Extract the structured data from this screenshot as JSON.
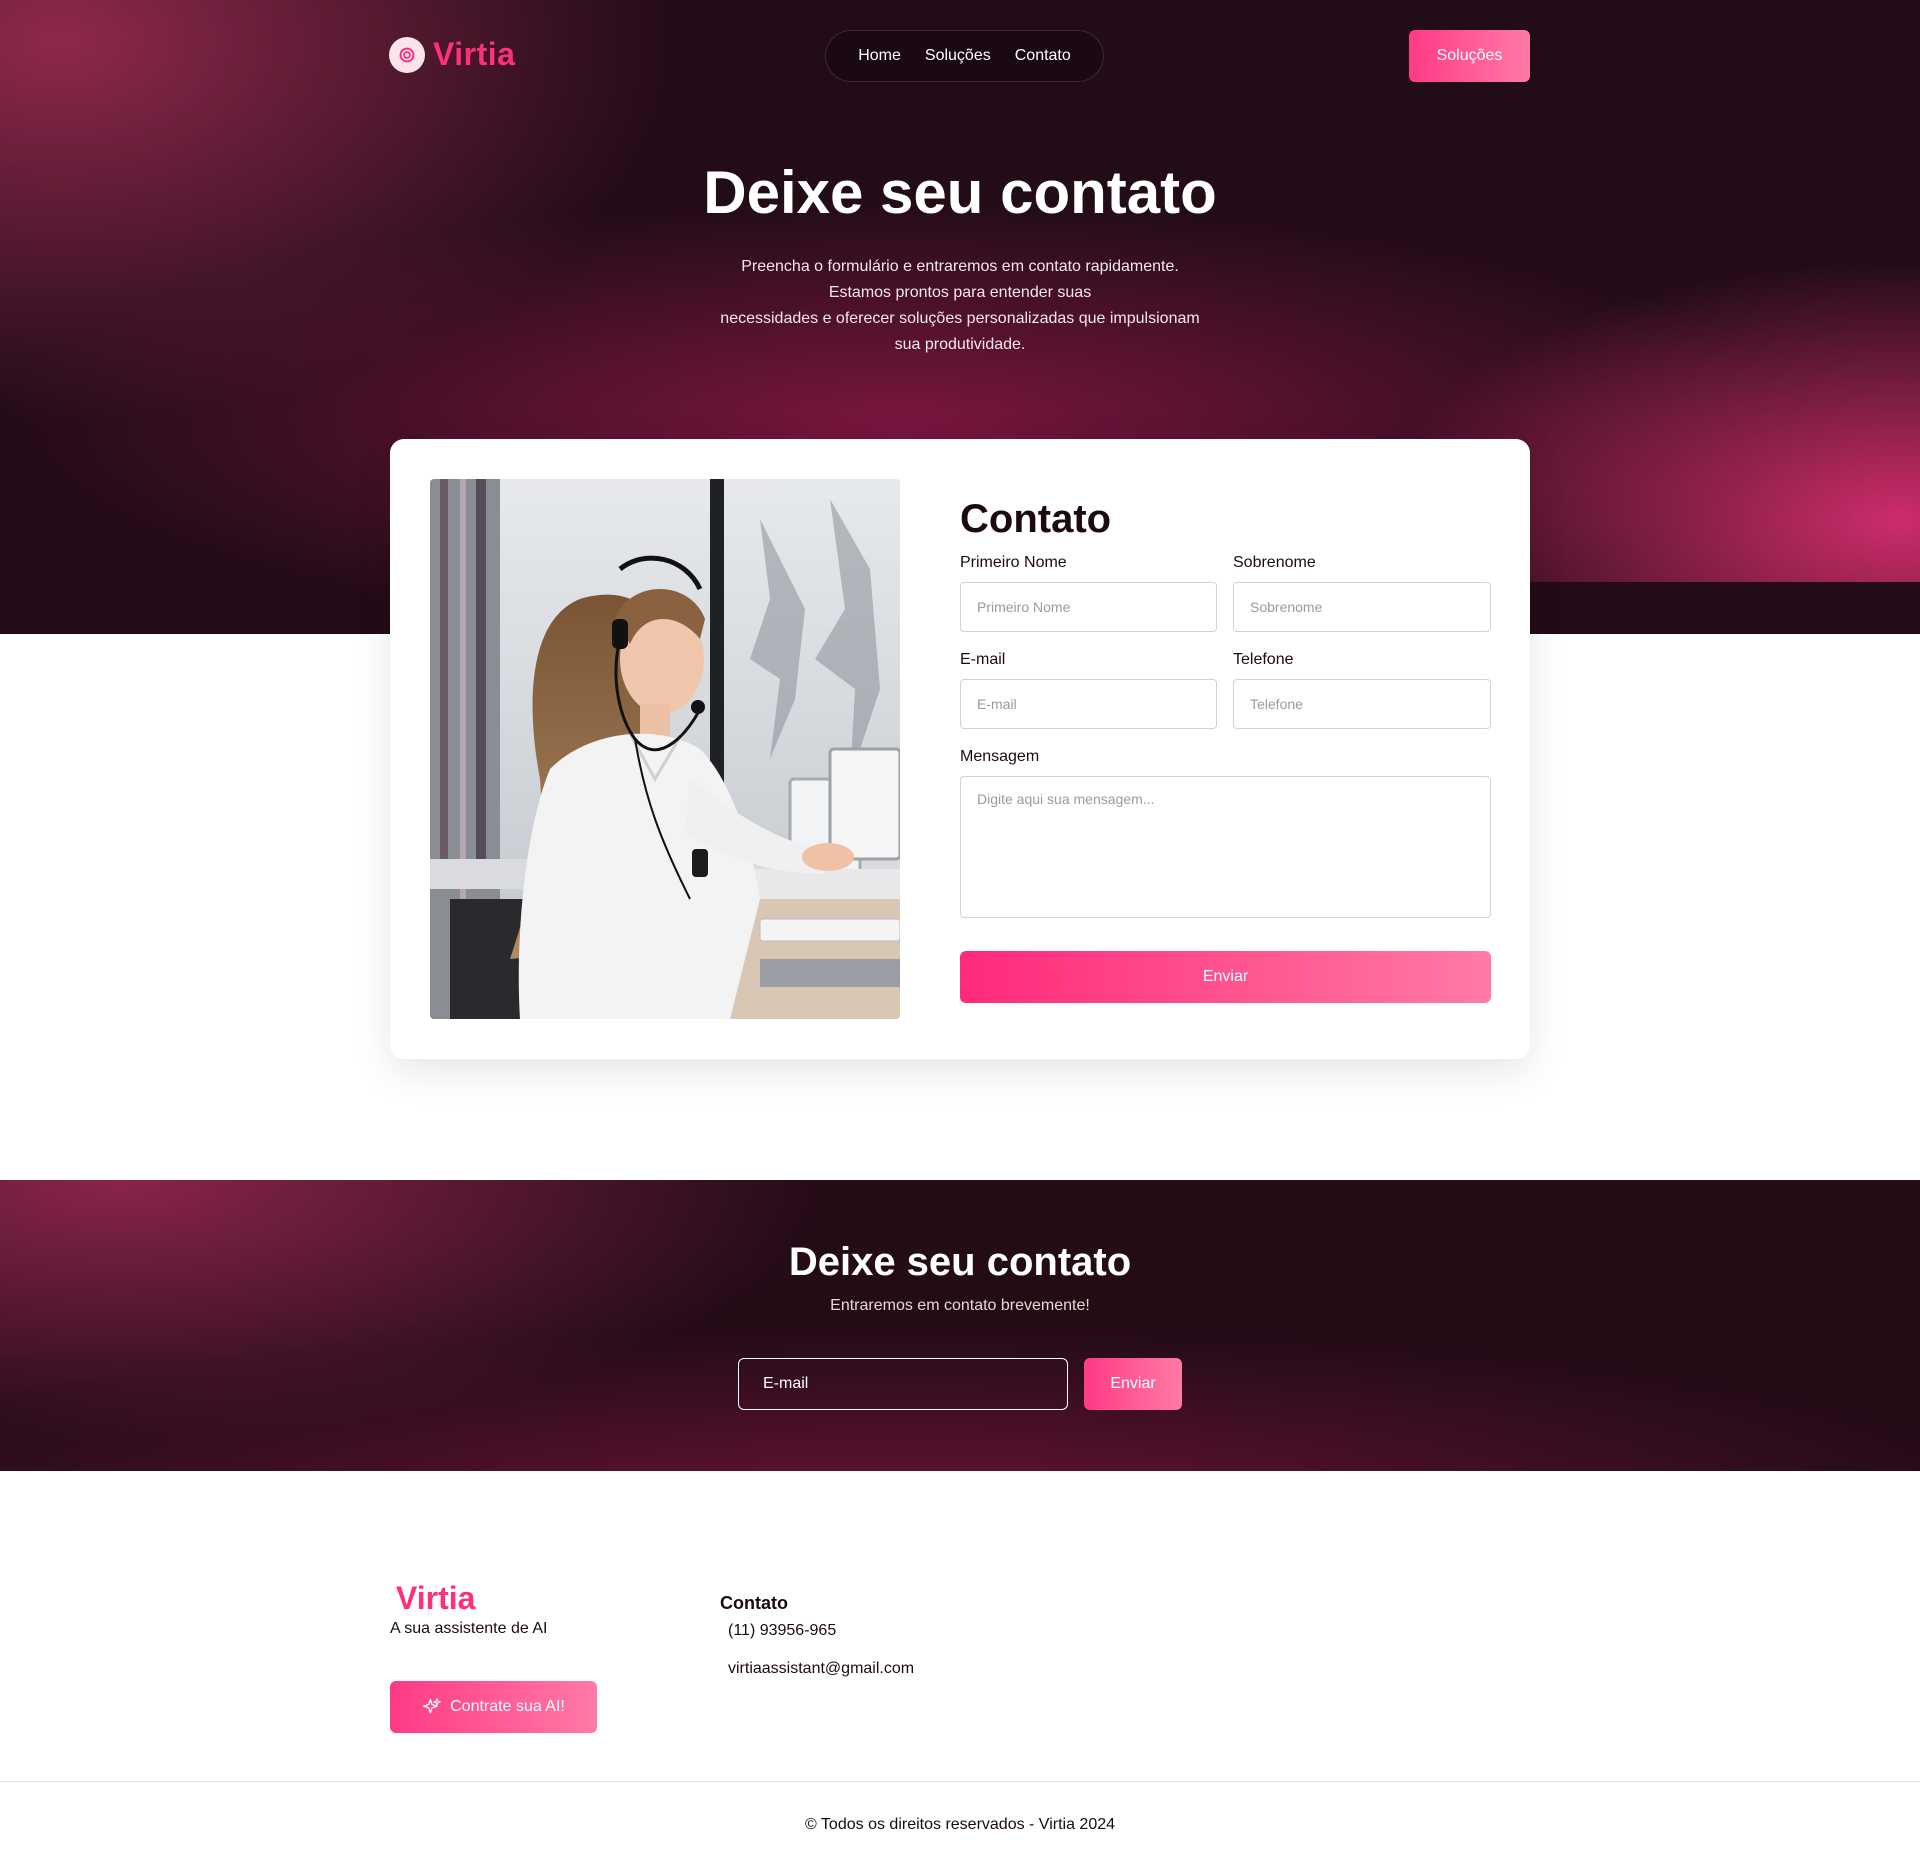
{
  "brand": {
    "name": "Virtia"
  },
  "nav": {
    "items": [
      {
        "label": "Home"
      },
      {
        "label": "Soluções"
      },
      {
        "label": "Contato"
      }
    ],
    "cta_label": "Soluções"
  },
  "hero": {
    "title": "Deixe seu contato",
    "subtitle_lines": [
      "Preencha o formulário e entraremos em contato rapidamente.",
      "Estamos prontos para entender suas",
      "necessidades e oferecer soluções personalizadas que impulsionam",
      "sua produtividade."
    ]
  },
  "contact_form": {
    "title": "Contato",
    "first_name": {
      "label": "Primeiro Nome",
      "placeholder": "Primeiro Nome"
    },
    "last_name": {
      "label": "Sobrenome",
      "placeholder": "Sobrenome"
    },
    "email": {
      "label": "E-mail",
      "placeholder": "E-mail"
    },
    "phone": {
      "label": "Telefone",
      "placeholder": "Telefone"
    },
    "message": {
      "label": "Mensagem",
      "placeholder": "Digite aqui sua mensagem..."
    },
    "submit_label": "Enviar"
  },
  "newsletter": {
    "title": "Deixe seu contato",
    "subtitle": "Entraremos em contato brevemente!",
    "email_placeholder": "E-mail",
    "submit_label": "Enviar"
  },
  "footer": {
    "brand": "Virtia",
    "tagline": "A sua assistente de AI",
    "cta_label": "Contrate sua AI!",
    "contact": {
      "title": "Contato",
      "phone": "(11) 93956-965",
      "email": "virtiaassistant@gmail.com"
    },
    "copyright": "© Todos os direitos reservados - Virtia 2024"
  },
  "colors": {
    "accent": "#ff2f7d",
    "dark_bg": "#220c17",
    "button_gradient_end": "#ff7aa7"
  }
}
